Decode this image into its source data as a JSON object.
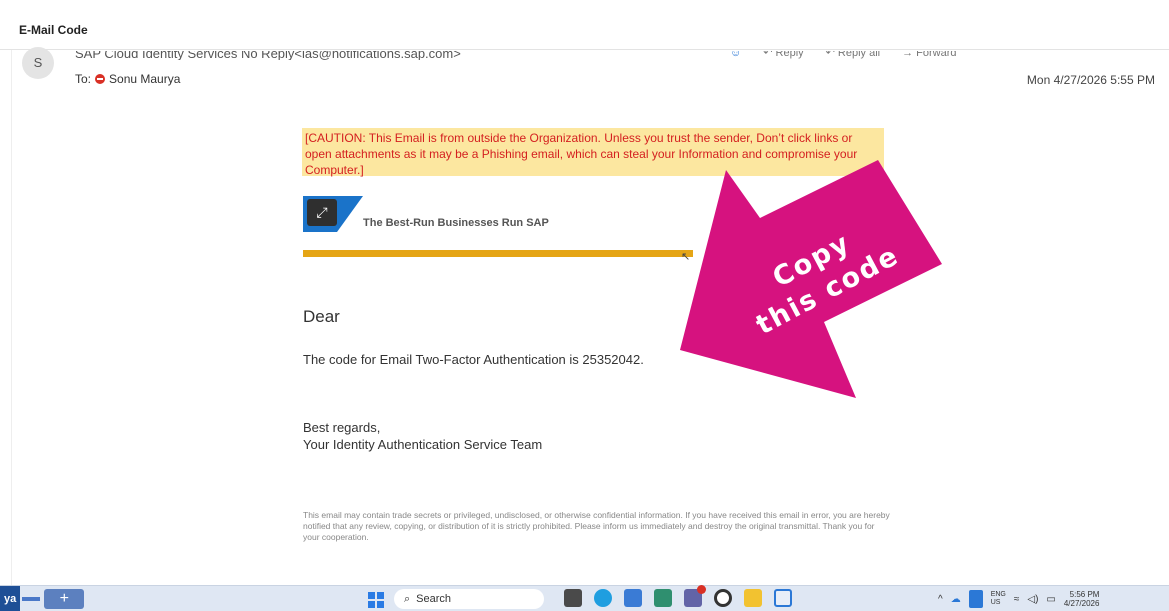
{
  "window": {
    "title": "E-Mail Code"
  },
  "header": {
    "avatar_initial": "S",
    "from": "SAP Cloud Identity Services No Reply<ias@notifications.sap.com>",
    "actions": {
      "reply": "Reply",
      "reply_all": "Reply all",
      "forward": "Forward"
    },
    "to_label": "To:",
    "recipient": "Sonu Maurya",
    "date": "Mon 4/27/2026 5:55 PM"
  },
  "email": {
    "caution": "[CAUTION: This Email is from outside the Organization. Unless you trust the sender, Don’t click links or open attachments as it may be a Phishing email, which can steal your Information and compromise your Computer.]",
    "tagline": "The Best-Run Businesses Run SAP",
    "greeting": "Dear",
    "code_sentence": "The code for Email Two-Factor Authentication is 25352042.",
    "regards_line1": "Best regards,",
    "regards_line2": "Your Identity Authentication Service Team",
    "disclaimer": "This email may contain trade secrets or privileged, undisclosed, or otherwise confidential information. If you have received this email in error, you are hereby notified that any review, copying, or distribution of it is strictly prohibited. Please inform us immediately and destroy the original transmittal. Thank you for your cooperation."
  },
  "overlay": {
    "line1": "Copy",
    "line2": "this code",
    "color": "#d6127f"
  },
  "taskbar": {
    "window_label": "ya",
    "plus": "+",
    "search_placeholder": "Search",
    "lang_line1": "ENG",
    "lang_line2": "US",
    "time": "5:56 PM",
    "date": "4/27/2026"
  },
  "colors": {
    "caution_bg": "#fce7a0",
    "caution_text": "#d42020",
    "sap_blue": "#1a73c9",
    "orange_bar": "#e5a515"
  }
}
